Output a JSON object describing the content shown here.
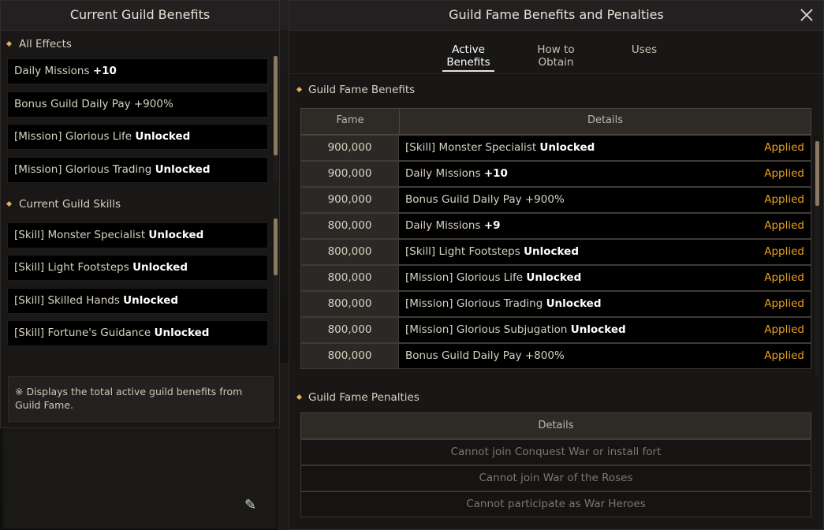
{
  "left_panel": {
    "title": "Current Guild Benefits",
    "all_effects_heading": "All Effects",
    "all_effects": [
      {
        "text": "Daily Missions ",
        "bold": "+10"
      },
      {
        "text": "Bonus Guild Daily Pay +900%",
        "bold": ""
      },
      {
        "text": "[Mission] Glorious Life ",
        "bold": "Unlocked"
      },
      {
        "text": "[Mission] Glorious Trading ",
        "bold": "Unlocked"
      }
    ],
    "skills_heading": "Current Guild Skills",
    "skills": [
      {
        "text": "[Skill] Monster Specialist ",
        "bold": "Unlocked"
      },
      {
        "text": "[Skill] Light Footsteps ",
        "bold": "Unlocked"
      },
      {
        "text": "[Skill] Skilled Hands ",
        "bold": "Unlocked"
      },
      {
        "text": "[Skill] Fortune's Guidance ",
        "bold": "Unlocked"
      }
    ],
    "notice": "※ Displays the total active guild benefits from Guild Fame."
  },
  "right_panel": {
    "title": "Guild Fame Benefits and Penalties",
    "tabs": [
      {
        "label": "Active Benefits",
        "active": true
      },
      {
        "label": "How to Obtain",
        "active": false
      },
      {
        "label": "Uses",
        "active": false
      }
    ],
    "benefits_heading": "Guild Fame Benefits",
    "benefits_columns": [
      "Fame",
      "Details"
    ],
    "benefits_rows": [
      {
        "fame": "900,000",
        "details": "[Skill] Monster Specialist ",
        "bold": "Unlocked",
        "status": "Applied"
      },
      {
        "fame": "900,000",
        "details": "Daily Missions ",
        "bold": "+10",
        "status": "Applied"
      },
      {
        "fame": "900,000",
        "details": "Bonus Guild Daily Pay +900%",
        "bold": "",
        "status": "Applied"
      },
      {
        "fame": "800,000",
        "details": "Daily Missions ",
        "bold": "+9",
        "status": "Applied"
      },
      {
        "fame": "800,000",
        "details": "[Skill] Light Footsteps ",
        "bold": "Unlocked",
        "status": "Applied"
      },
      {
        "fame": "800,000",
        "details": "[Mission] Glorious Life ",
        "bold": "Unlocked",
        "status": "Applied"
      },
      {
        "fame": "800,000",
        "details": "[Mission] Glorious Trading ",
        "bold": "Unlocked",
        "status": "Applied"
      },
      {
        "fame": "800,000",
        "details": "[Mission] Glorious Subjugation ",
        "bold": "Unlocked",
        "status": "Applied"
      },
      {
        "fame": "800,000",
        "details": "Bonus Guild Daily Pay +800%",
        "bold": "",
        "status": "Applied"
      }
    ],
    "penalties_heading": "Guild Fame Penalties",
    "penalties_column": "Details",
    "penalties_rows": [
      "Cannot join Conquest War or install fort",
      "Cannot join War of the Roses",
      "Cannot participate as War Heroes"
    ]
  },
  "colors": {
    "accent_gold": "#e0b25a",
    "applied_orange": "#e8a21a"
  }
}
